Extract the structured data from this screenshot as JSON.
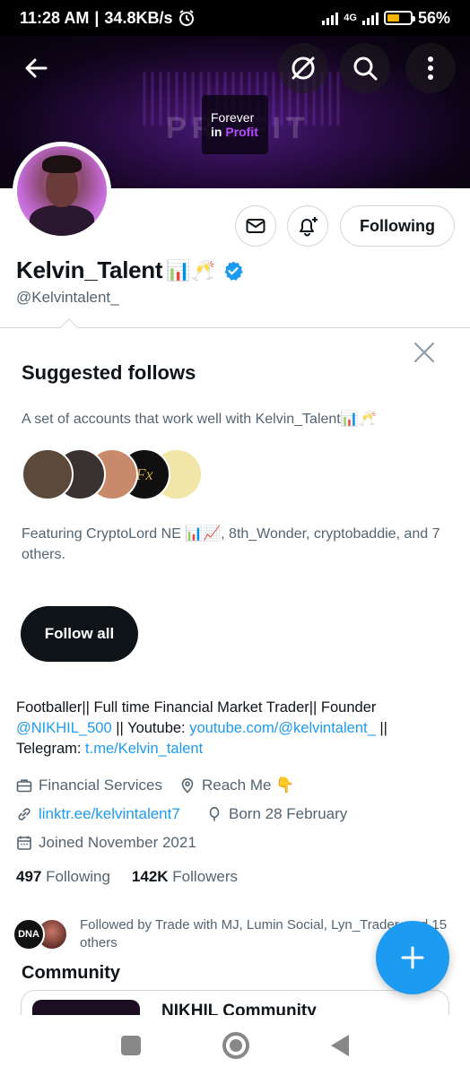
{
  "status_bar": {
    "time": "11:28 AM",
    "speed": "34.8KB/s",
    "network": "4G",
    "battery": "56%",
    "battery_level": 0.56
  },
  "banner": {
    "ghost_text": "PROFIT",
    "logo_line1": "Forever",
    "logo_line2_a": "in",
    "logo_line2_b": "Profit"
  },
  "actions": {
    "following_label": "Following"
  },
  "profile": {
    "name": "Kelvin_Talent",
    "name_emojis": "📊🥂",
    "handle": "@Kelvintalent_"
  },
  "suggested": {
    "title": "Suggested follows",
    "description": "A set of accounts that work well with Kelvin_Talent📊🥂",
    "featuring": "Featuring CryptoLord NE 📊📈, 8th_Wonder, cryptobaddie, and 7 others.",
    "follow_all_label": "Follow all",
    "avatars": [
      "#5b4a3a",
      "#3a3230",
      "#c88a6a",
      "#101010",
      "#f1e6a8"
    ],
    "fx_text": "Fx"
  },
  "bio": {
    "part1": "Footballer|| Full time Financial Market Trader|| Founder ",
    "mention": "@NIKHIL_500",
    "part2": " || Youtube: ",
    "youtube": "youtube.com/@kelvintalent_",
    "part3": " || Telegram: ",
    "telegram": "t.me/Kelvin_talent"
  },
  "meta": {
    "category": "Financial Services",
    "location": "Reach Me 👇",
    "website": "linktr.ee/kelvintalent7",
    "birthday": "Born 28 February",
    "joined": "Joined November 2021"
  },
  "stats": {
    "following_count": "497",
    "following_label": "Following",
    "followers_count": "142K",
    "followers_label": "Followers"
  },
  "followed_by": {
    "text": "Followed by Trade with MJ, Lumin Social, Lyn_Trader, and 15 others",
    "avatar1_text": "DNA"
  },
  "community": {
    "section_title": "Community",
    "name": "NIKHIL Community"
  },
  "colors": {
    "accent": "#1d9bf0",
    "verified": "#1d9bf0",
    "text_secondary": "#536471",
    "button_dark": "#0f1419"
  }
}
